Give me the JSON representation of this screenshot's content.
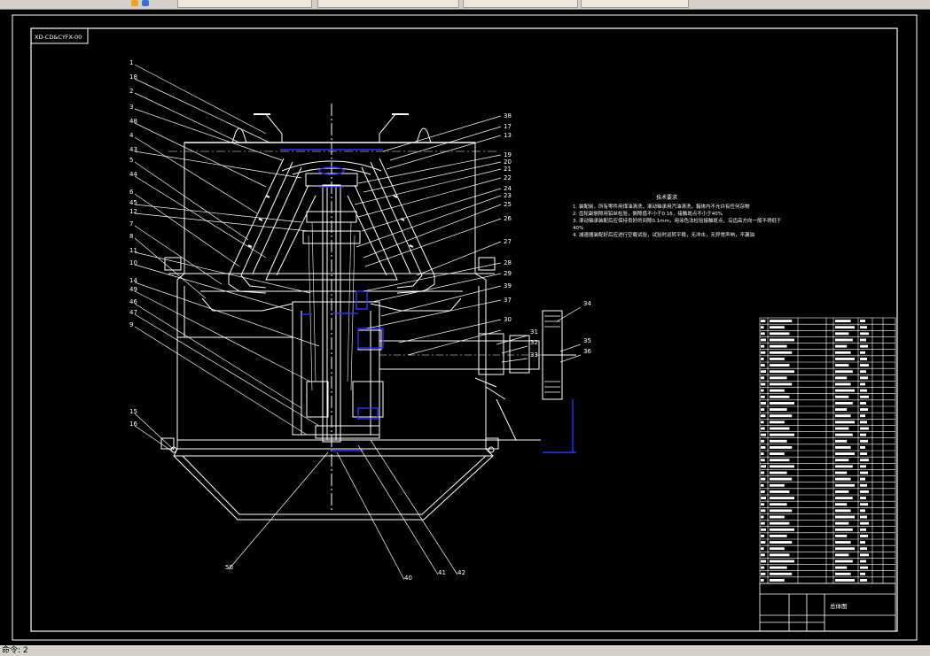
{
  "title_block_code": "XD-CD&CYFX-00",
  "part_callouts_left": [
    "1",
    "18",
    "2",
    "3",
    "48",
    "4",
    "43",
    "5",
    "44",
    "6",
    "45",
    "12",
    "7",
    "8",
    "11",
    "10",
    "14",
    "49",
    "46",
    "47",
    "9",
    "15",
    "16"
  ],
  "part_callouts_right": [
    "38",
    "17",
    "13",
    "19",
    "20",
    "21",
    "22",
    "24",
    "23",
    "25",
    "26",
    "27",
    "28",
    "29",
    "39",
    "37",
    "30",
    "31",
    "32",
    "33",
    "34",
    "35",
    "36"
  ],
  "part_callouts_bottom": [
    "50",
    "40",
    "41",
    "42"
  ],
  "tech_notes": {
    "heading": "技术要求",
    "lines": [
      "1. 装配前，所有零件用煤油清洗，滚动轴承用汽油清洗，箱体内不允许有任何杂物",
      "2. 齿轮副侧隙用铅丝检验，侧隙值不小于0.16，接触斑点不小于40%",
      "3. 滚动轴承装配后应保持良好的间隙0.1mm，用涂色法检验接触斑点，沿齿高方向一般不得低于",
      "   40%",
      "4. 减速器装配好后应进行空载试验，试验时运转平稳，无冲击，无异常声响，不漏油"
    ]
  },
  "title_block": {
    "drawing_name": "总体图"
  },
  "status_bar": {
    "text": "命令: 2"
  },
  "colors": {
    "accent_blue": "#3030ff",
    "line_white": "#ffffff",
    "background": "#000000"
  }
}
